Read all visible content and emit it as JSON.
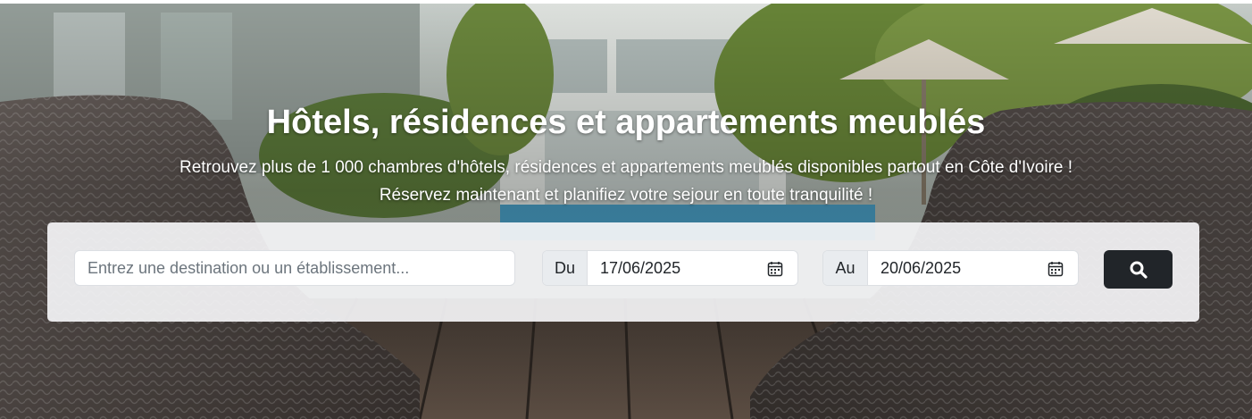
{
  "hero": {
    "title": "Hôtels, résidences et appartements meublés",
    "subtitle_line1": "Retrouvez plus de 1 000 chambres d'hôtels, résidences et appartements meublés disponibles partout en Côte d'Ivoire !",
    "subtitle_line2": "Réservez maintenant et planifiez votre sejour en toute tranquilité !"
  },
  "search": {
    "destination_placeholder": "Entrez une destination ou un établissement...",
    "destination_value": "",
    "from_label": "Du",
    "from_date": "17/06/2025",
    "to_label": "Au",
    "to_date": "20/06/2025",
    "button_icon": "search-icon"
  },
  "colors": {
    "button_bg": "#212529",
    "panel_bg": "#f5f5f7",
    "addon_bg": "#e9ecef",
    "title_text": "#ffffff"
  }
}
